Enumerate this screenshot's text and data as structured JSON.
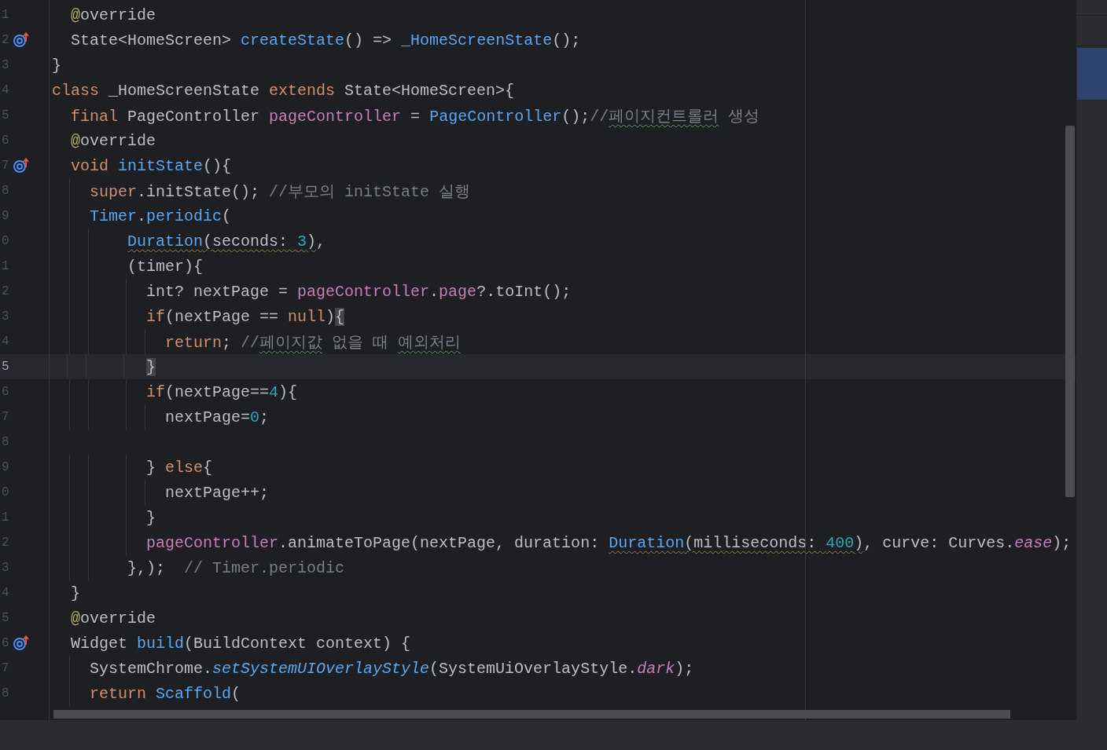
{
  "editor": {
    "lines": [
      {
        "line_number": "1",
        "tokens": [
          {
            "kind": "annotation",
            "text": "  @"
          },
          {
            "kind": "plain",
            "text": "override"
          }
        ]
      },
      {
        "line_number": "2",
        "marker": true,
        "tokens": [
          {
            "kind": "plain",
            "text": "  State<HomeScreen> "
          },
          {
            "kind": "function",
            "text": "createState"
          },
          {
            "kind": "plain",
            "text": "() => "
          },
          {
            "kind": "function",
            "text": "_HomeScreenState"
          },
          {
            "kind": "plain",
            "text": "();"
          }
        ]
      },
      {
        "line_number": "3",
        "tokens": [
          {
            "kind": "plain",
            "text": "}"
          }
        ]
      },
      {
        "line_number": "4",
        "tokens": [
          {
            "kind": "keyword",
            "text": "class "
          },
          {
            "kind": "plain",
            "text": "_HomeScreenState "
          },
          {
            "kind": "keyword",
            "text": "extends "
          },
          {
            "kind": "plain",
            "text": "State<HomeScreen>{"
          }
        ]
      },
      {
        "line_number": "5",
        "tokens": [
          {
            "kind": "keyword",
            "text": "  final "
          },
          {
            "kind": "plain",
            "text": "PageController "
          },
          {
            "kind": "field",
            "text": "pageController"
          },
          {
            "kind": "plain",
            "text": " = "
          },
          {
            "kind": "function",
            "text": "PageController"
          },
          {
            "kind": "plain",
            "text": "();"
          },
          {
            "kind": "comment",
            "text": "//"
          },
          {
            "kind": "comment",
            "text": "페이지컨트롤러",
            "typo": true
          },
          {
            "kind": "comment",
            "text": " 생성"
          }
        ]
      },
      {
        "line_number": "6",
        "tokens": [
          {
            "kind": "annotation",
            "text": "  @"
          },
          {
            "kind": "plain",
            "text": "override"
          }
        ]
      },
      {
        "line_number": "7",
        "marker": true,
        "tokens": [
          {
            "kind": "keyword",
            "text": "  void "
          },
          {
            "kind": "function",
            "text": "initState"
          },
          {
            "kind": "plain",
            "text": "(){"
          }
        ]
      },
      {
        "line_number": "8",
        "tokens": [
          {
            "kind": "keyword",
            "text": "    super"
          },
          {
            "kind": "plain",
            "text": ".initState(); "
          },
          {
            "kind": "comment",
            "text": "//부모의 initState 실행"
          }
        ]
      },
      {
        "line_number": "9",
        "tokens": [
          {
            "kind": "function",
            "text": "    Timer"
          },
          {
            "kind": "plain",
            "text": "."
          },
          {
            "kind": "function",
            "text": "periodic"
          },
          {
            "kind": "plain",
            "text": "("
          }
        ]
      },
      {
        "line_number": "0",
        "tokens": [
          {
            "kind": "function",
            "text": "        Duration",
            "warning": true
          },
          {
            "kind": "plain",
            "text": "(seconds: ",
            "warning": true
          },
          {
            "kind": "number",
            "text": "3",
            "warning": true
          },
          {
            "kind": "plain",
            "text": ")",
            "warning": true
          },
          {
            "kind": "plain",
            "text": ","
          }
        ]
      },
      {
        "line_number": "1",
        "tokens": [
          {
            "kind": "plain",
            "text": "        (timer){"
          }
        ]
      },
      {
        "line_number": "2",
        "tokens": [
          {
            "kind": "plain",
            "text": "          int? nextPage = "
          },
          {
            "kind": "field",
            "text": "pageController"
          },
          {
            "kind": "plain",
            "text": "."
          },
          {
            "kind": "field",
            "text": "page"
          },
          {
            "kind": "plain",
            "text": "?.toInt();"
          }
        ]
      },
      {
        "line_number": "3",
        "tokens": [
          {
            "kind": "keyword",
            "text": "          if"
          },
          {
            "kind": "plain",
            "text": "(nextPage == "
          },
          {
            "kind": "keyword",
            "text": "null"
          },
          {
            "kind": "plain",
            "text": ")"
          },
          {
            "kind": "plain",
            "text": "{",
            "matched": true
          }
        ]
      },
      {
        "line_number": "4",
        "tokens": [
          {
            "kind": "keyword",
            "text": "            return"
          },
          {
            "kind": "plain",
            "text": "; "
          },
          {
            "kind": "comment",
            "text": "//"
          },
          {
            "kind": "comment",
            "text": "페이지값",
            "typo": true
          },
          {
            "kind": "comment",
            "text": " 없을 때 "
          },
          {
            "kind": "comment",
            "text": "예외처리",
            "typo": true
          }
        ]
      },
      {
        "line_number": "5",
        "current": true,
        "tokens": [
          {
            "kind": "plain",
            "text": "          }",
            "matched": true
          }
        ]
      },
      {
        "line_number": "6",
        "tokens": [
          {
            "kind": "keyword",
            "text": "          if"
          },
          {
            "kind": "plain",
            "text": "(nextPage=="
          },
          {
            "kind": "number",
            "text": "4"
          },
          {
            "kind": "plain",
            "text": "){"
          }
        ]
      },
      {
        "line_number": "7",
        "tokens": [
          {
            "kind": "plain",
            "text": "            nextPage="
          },
          {
            "kind": "number",
            "text": "0"
          },
          {
            "kind": "plain",
            "text": ";"
          }
        ]
      },
      {
        "line_number": "8"
      },
      {
        "line_number": "9",
        "tokens": [
          {
            "kind": "plain",
            "text": "          } "
          },
          {
            "kind": "keyword",
            "text": "else"
          },
          {
            "kind": "plain",
            "text": "{"
          }
        ]
      },
      {
        "line_number": "0",
        "tokens": [
          {
            "kind": "plain",
            "text": "            nextPage++;"
          }
        ]
      },
      {
        "line_number": "1",
        "tokens": [
          {
            "kind": "plain",
            "text": "          }"
          }
        ]
      },
      {
        "line_number": "2",
        "tokens": [
          {
            "kind": "field",
            "text": "          pageController"
          },
          {
            "kind": "plain",
            "text": ".animateToPage(nextPage, duration: "
          },
          {
            "kind": "function",
            "text": "Duration",
            "warning": true
          },
          {
            "kind": "plain",
            "text": "(milliseconds: ",
            "warning": true
          },
          {
            "kind": "number",
            "text": "400",
            "warning": true
          },
          {
            "kind": "plain",
            "text": ")",
            "warning": true
          },
          {
            "kind": "plain",
            "text": ", curve: Curves."
          },
          {
            "kind": "static",
            "text": "ease"
          },
          {
            "kind": "plain",
            "text": ");"
          }
        ]
      },
      {
        "line_number": "3",
        "tokens": [
          {
            "kind": "plain",
            "text": "        },);  "
          },
          {
            "kind": "comment",
            "text": "// Timer.periodic"
          }
        ]
      },
      {
        "line_number": "4",
        "tokens": [
          {
            "kind": "plain",
            "text": "  }"
          }
        ]
      },
      {
        "line_number": "5",
        "tokens": [
          {
            "kind": "annotation",
            "text": "  @"
          },
          {
            "kind": "plain",
            "text": "override"
          }
        ]
      },
      {
        "line_number": "6",
        "marker": true,
        "tokens": [
          {
            "kind": "plain",
            "text": "  Widget "
          },
          {
            "kind": "function",
            "text": "build"
          },
          {
            "kind": "plain",
            "text": "(BuildContext context) {"
          }
        ]
      },
      {
        "line_number": "7",
        "tokens": [
          {
            "kind": "plain",
            "text": "    SystemChrome."
          },
          {
            "kind": "static_function",
            "text": "setSystemUIOverlayStyle"
          },
          {
            "kind": "plain",
            "text": "(SystemUiOverlayStyle."
          },
          {
            "kind": "static",
            "text": "dark"
          },
          {
            "kind": "plain",
            "text": ");"
          }
        ]
      },
      {
        "line_number": "8",
        "tokens": [
          {
            "kind": "keyword",
            "text": "    return "
          },
          {
            "kind": "function",
            "text": "Scaffold"
          },
          {
            "kind": "plain",
            "text": "("
          }
        ]
      }
    ]
  }
}
